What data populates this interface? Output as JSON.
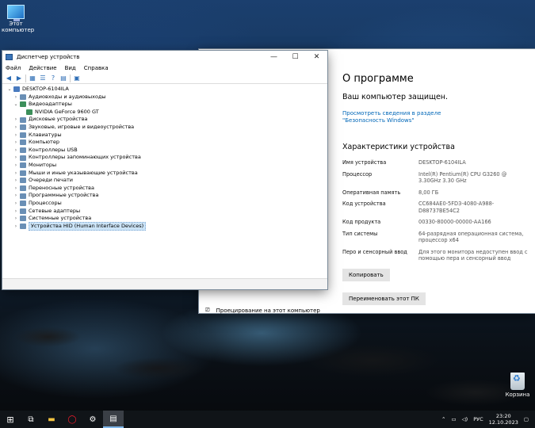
{
  "desktop": {
    "this_pc_label_1": "Этот",
    "this_pc_label_2": "компьютер",
    "recycle_bin_label": "Корзина"
  },
  "device_manager": {
    "title": "Диспетчер устройств",
    "menu": [
      "Файл",
      "Действие",
      "Вид",
      "Справка"
    ],
    "tree": {
      "root": "DESKTOP-6104ILA",
      "items": [
        {
          "label": "Аудиовходы и аудиовыходы",
          "expanded": false
        },
        {
          "label": "Видеоадаптеры",
          "expanded": true
        },
        {
          "label": "NVIDIA GeForce 9600 GT",
          "child": true
        },
        {
          "label": "Дисковые устройства",
          "expanded": false
        },
        {
          "label": "Звуковые, игровые и видеоустройства",
          "expanded": false
        },
        {
          "label": "Клавиатуры",
          "expanded": false
        },
        {
          "label": "Компьютер",
          "expanded": false
        },
        {
          "label": "Контроллеры USB",
          "expanded": false
        },
        {
          "label": "Контроллеры запоминающих устройства",
          "expanded": false
        },
        {
          "label": "Мониторы",
          "expanded": false
        },
        {
          "label": "Мыши и иные указывающие устройства",
          "expanded": false
        },
        {
          "label": "Очереди печати",
          "expanded": false
        },
        {
          "label": "Переносные устройства",
          "expanded": false
        },
        {
          "label": "Программные устройства",
          "expanded": false
        },
        {
          "label": "Процессоры",
          "expanded": false
        },
        {
          "label": "Сетевые адаптеры",
          "expanded": false
        },
        {
          "label": "Системные устройства",
          "expanded": false
        },
        {
          "label": "Устройства HID (Human Interface Devices)",
          "expanded": false,
          "selected": true
        }
      ]
    }
  },
  "about": {
    "heading": "О программе",
    "protected": "Ваш компьютер защищен.",
    "security_link": "Просмотреть сведения в разделе \"Безопасность Windows\"",
    "specs_heading": "Характеристики устройства",
    "specs": [
      {
        "key": "Имя устройства",
        "value": "DESKTOP-6104ILA"
      },
      {
        "key": "Процессор",
        "value": "Intel(R) Pentium(R) CPU G3260 @ 3.30GHz   3.30 GHz"
      },
      {
        "key": "Оперативная память",
        "value": "8,00 ГБ"
      },
      {
        "key": "Код устройства",
        "value": "CC684AE0-5FD3-4080-A988-D88737BE54C2"
      },
      {
        "key": "Код продукта",
        "value": "00330-80000-00000-AA166"
      },
      {
        "key": "Тип системы",
        "value": "64-разрядная операционная система, процессор x64"
      },
      {
        "key": "Перо и сенсорный ввод",
        "value": "Для этого монитора недоступен ввод с помощью пера и сенсорный ввод"
      }
    ],
    "copy_button": "Копировать",
    "rename_button": "Переименовать этот ПК",
    "projection_label": "Проецирование на этот компьютер"
  },
  "taskbar": {
    "language": "РУС",
    "time": "23:20",
    "date": "12.10.2023"
  }
}
